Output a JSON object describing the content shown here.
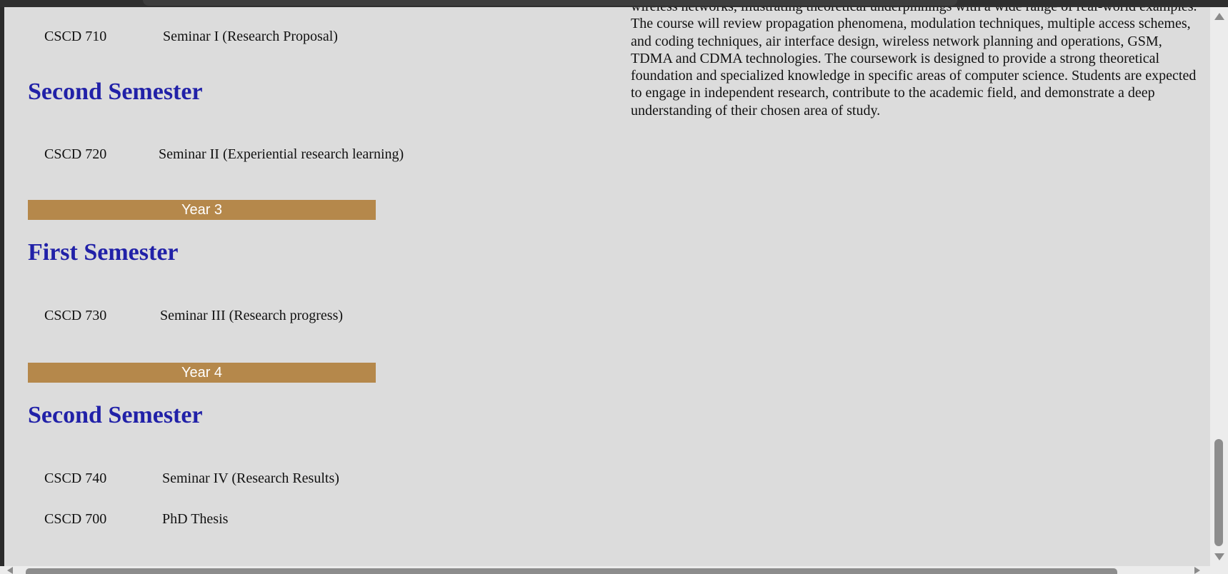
{
  "courses_top": {
    "code": "CSCD 710",
    "title": "Seminar I (Research Proposal)"
  },
  "sections": [
    {
      "heading": "Second Semester",
      "courses": [
        {
          "code": "CSCD 720",
          "title": "Seminar II (Experiential research learning)"
        }
      ]
    },
    {
      "year": "Year 3",
      "heading": "First Semester",
      "courses": [
        {
          "code": "CSCD 730",
          "title": "Seminar III (Research progress)"
        }
      ]
    },
    {
      "year": "Year 4",
      "heading": "Second Semester",
      "courses": [
        {
          "code": "CSCD 740",
          "title": "Seminar IV (Research Results)"
        },
        {
          "code": "CSCD 700",
          "title": "PhD Thesis"
        }
      ]
    }
  ],
  "description": "wireless networks, illustrating theoretical underpinnings with a wide range of real-world examples. The course will review propagation phenomena, modulation techniques, multiple access schemes, and coding techniques, air interface design, wireless network planning and operations, GSM, TDMA and CDMA technologies. The coursework is designed to provide a strong theoretical foundation and specialized knowledge in specific areas of computer science. Students are expected to engage in independent research, contribute to the academic field, and demonstrate a deep understanding of their chosen area of study.",
  "colors": {
    "heading": "#2121a8",
    "year_bar": "#b5884b",
    "background": "#dcdcdc"
  },
  "scrollbars": {
    "vertical": "scrollbar",
    "horizontal": "scrollbar"
  }
}
